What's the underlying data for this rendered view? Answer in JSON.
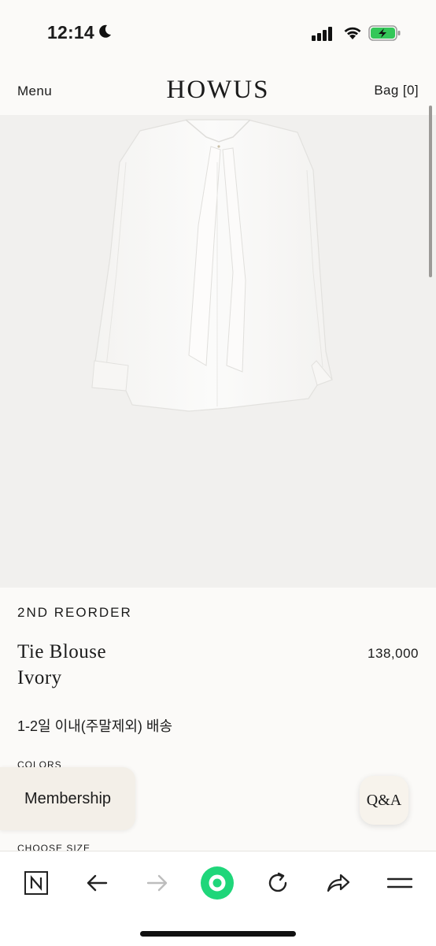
{
  "status_bar": {
    "time": "12:14"
  },
  "header": {
    "menu_label": "Menu",
    "logo": "HOWUS",
    "bag_label": "Bag [0]"
  },
  "product": {
    "tag": "2ND REORDER",
    "name_line1": "Tie Blouse",
    "name_line2": "Ivory",
    "price": "138,000",
    "shipping": "1-2일 이내(주말제외) 배송",
    "colors_label": "COLORS",
    "size_label": "CHOOSE SIZE"
  },
  "floating": {
    "membership_label": "Membership",
    "qa_label": "Q&A"
  },
  "toolbar": {
    "icons": [
      "naver-n-icon",
      "back-arrow-icon",
      "forward-arrow-icon",
      "green-dot-icon",
      "reload-icon",
      "share-icon",
      "menu-icon"
    ]
  },
  "colors": {
    "accent_green": "#1fd67a",
    "background": "#fbfaf8",
    "image_bg": "#f1f0ee"
  }
}
